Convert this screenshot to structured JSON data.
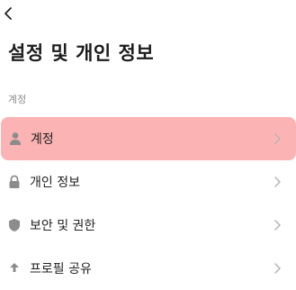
{
  "header": {
    "title": "설정 및 개인 정보"
  },
  "section": {
    "title": "계정"
  },
  "items": [
    {
      "label": "계정",
      "icon": "person-icon",
      "selected": true
    },
    {
      "label": "개인 정보",
      "icon": "lock-icon",
      "selected": false
    },
    {
      "label": "보안 및 권한",
      "icon": "shield-icon",
      "selected": false
    },
    {
      "label": "프로필 공유",
      "icon": "share-icon",
      "selected": false
    }
  ],
  "colors": {
    "highlight": "#fcb3b3",
    "icon": "#8c8c8c",
    "chevron": "#b4b4b4",
    "text": "#222222"
  }
}
